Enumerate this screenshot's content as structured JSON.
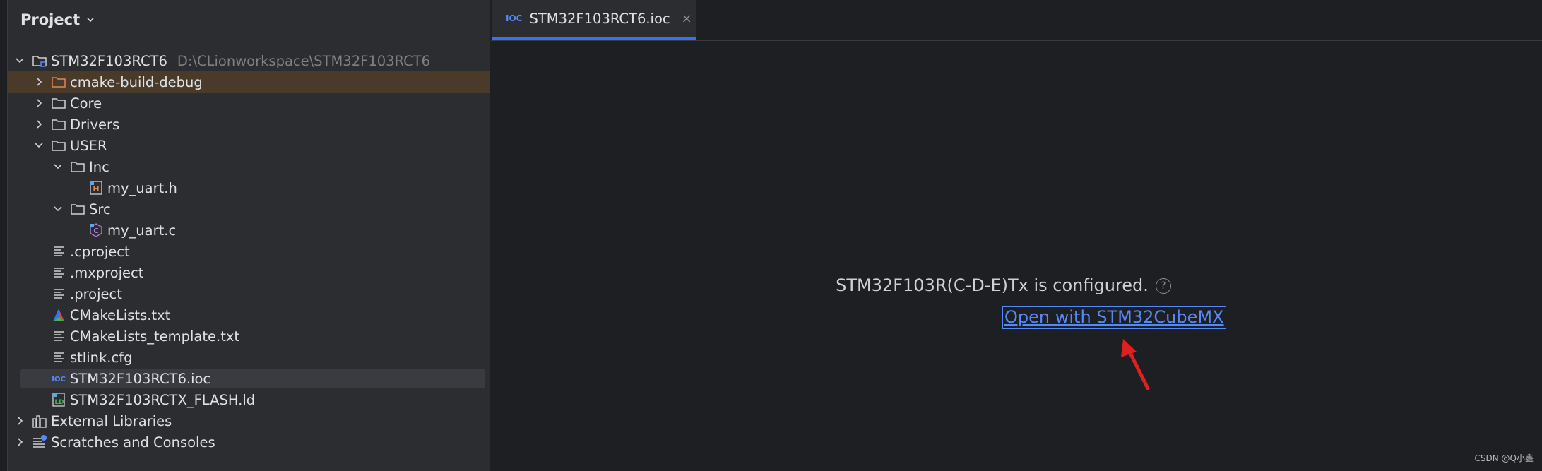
{
  "panel": {
    "title": "Project"
  },
  "tree": [
    {
      "label": "STM32F103RCT6",
      "extra": "D:\\CLionworkspace\\STM32F103RCT6",
      "icon": "module-folder-icon",
      "expanded": true
    },
    {
      "label": "cmake-build-debug",
      "icon": "excluded-folder-icon",
      "expanded": false
    },
    {
      "label": "Core",
      "icon": "folder-icon",
      "expanded": false
    },
    {
      "label": "Drivers",
      "icon": "folder-icon",
      "expanded": false
    },
    {
      "label": "USER",
      "icon": "folder-icon",
      "expanded": true
    },
    {
      "label": "Inc",
      "icon": "folder-icon",
      "expanded": true
    },
    {
      "label": "my_uart.h",
      "icon": "header-file-icon"
    },
    {
      "label": "Src",
      "icon": "folder-icon",
      "expanded": true
    },
    {
      "label": "my_uart.c",
      "icon": "c-file-icon"
    },
    {
      "label": ".cproject",
      "icon": "text-file-icon"
    },
    {
      "label": ".mxproject",
      "icon": "text-file-icon"
    },
    {
      "label": ".project",
      "icon": "text-file-icon"
    },
    {
      "label": "CMakeLists.txt",
      "icon": "cmake-icon"
    },
    {
      "label": "CMakeLists_template.txt",
      "icon": "text-file-icon"
    },
    {
      "label": "stlink.cfg",
      "icon": "text-file-icon"
    },
    {
      "label": "STM32F103RCT6.ioc",
      "icon": "ioc-file-icon",
      "selected": true
    },
    {
      "label": "STM32F103RCTX_FLASH.ld",
      "icon": "linker-file-icon"
    },
    {
      "label": "External Libraries",
      "icon": "libraries-icon",
      "expanded": false
    },
    {
      "label": "Scratches and Consoles",
      "icon": "scratches-icon",
      "expanded": false
    }
  ],
  "editor": {
    "tab_label": "STM32F103RCT6.ioc",
    "tab_icon_text": "IOC",
    "close_glyph": "×",
    "message": "STM32F103R(C-D-E)Tx is configured.",
    "help_glyph": "?",
    "link": "Open with STM32CubeMX"
  },
  "watermark": "CSDN @Q小鑫",
  "colors": {
    "accent": "#548af7",
    "annotation_arrow": "#e02020",
    "highlight_row": "#4a3a2a"
  }
}
